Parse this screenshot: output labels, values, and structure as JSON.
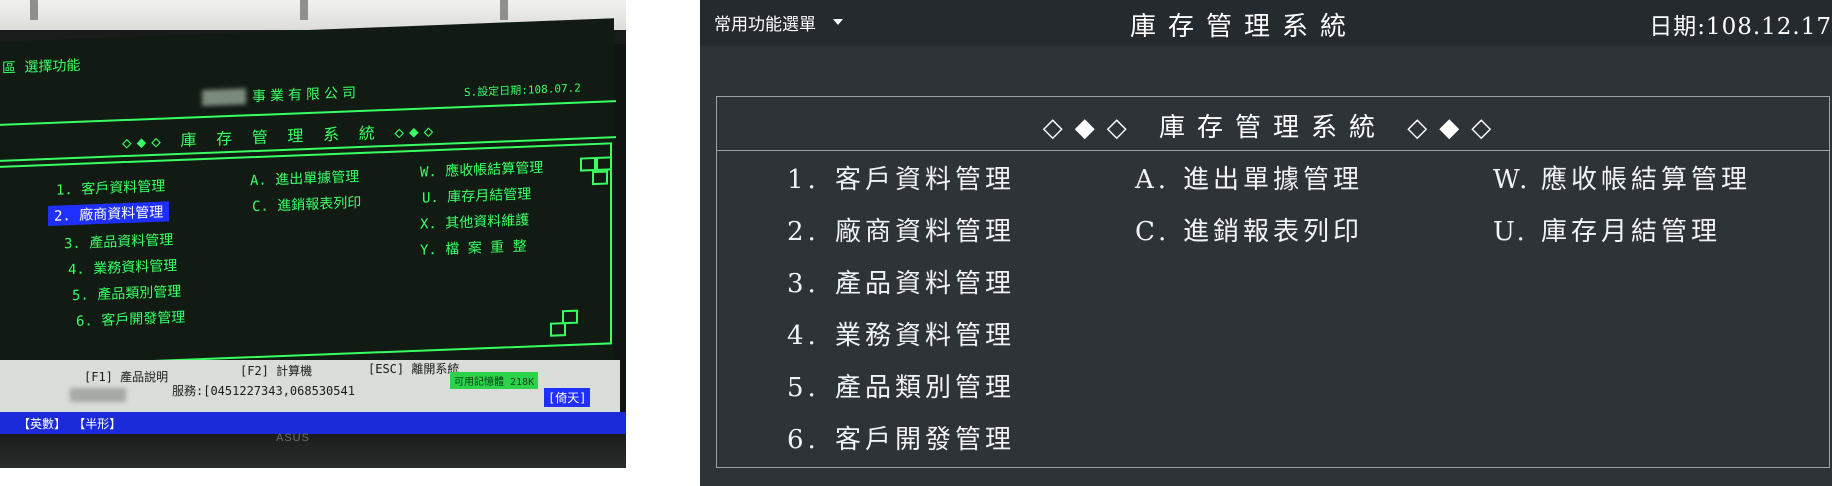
{
  "photo": {
    "screen": {
      "header_left": "區 選擇功能",
      "company": "事業有限公司",
      "set_date": "S.設定日期:108.07.2",
      "menu_title": "◇◆◇ 庫 存 管 理 系 統 ◇◆◇",
      "col1": [
        "1. 客戶資料管理",
        "2. 廠商資料管理",
        "3. 產品資料管理",
        "4. 業務資料管理",
        "5. 產品類別管理",
        "6. 客戶開發管理"
      ],
      "selected_index": 1,
      "col2": [
        "A. 進出單據管理",
        "C. 進銷報表列印"
      ],
      "col3": [
        "W. 應收帳結算管理",
        "U. 庫存月結管理",
        "X. 其他資料維護",
        "Y. 檔 案 重 整"
      ],
      "f1": "[F1] 產品說明",
      "f2": "[F2] 計算機",
      "esc": "[ESC] 離開系統",
      "memory": "可用記憶體 218K",
      "serial": "服務:[0451227343,068530541",
      "day": "[倚天]",
      "ime": "【英數】 【半形】",
      "brand": "ASUS"
    }
  },
  "terminal": {
    "quick_menu_label": "常用功能選單",
    "system_title": "庫存管理系統",
    "date_text": "日期:108.12.17",
    "panel_title": "◇◆◇ 庫存管理系統 ◇◆◇",
    "menu": {
      "col1": [
        {
          "key": "1.",
          "label": "客戶資料管理"
        },
        {
          "key": "2.",
          "label": "廠商資料管理"
        },
        {
          "key": "3.",
          "label": "產品資料管理"
        },
        {
          "key": "4.",
          "label": "業務資料管理"
        },
        {
          "key": "5.",
          "label": "產品類別管理"
        },
        {
          "key": "6.",
          "label": "客戶開發管理"
        }
      ],
      "col2": [
        {
          "key": "A.",
          "label": "進出單據管理"
        },
        {
          "key": "C.",
          "label": "進銷報表列印"
        }
      ],
      "col3": [
        {
          "key": "W.",
          "label": "應收帳結算管理"
        },
        {
          "key": "U.",
          "label": "庫存月結管理"
        }
      ]
    },
    "colors": {
      "background": "#2e3338",
      "topbar": "#252a2f",
      "border": "#9aa0a6",
      "text": "#f2f3f5"
    }
  }
}
